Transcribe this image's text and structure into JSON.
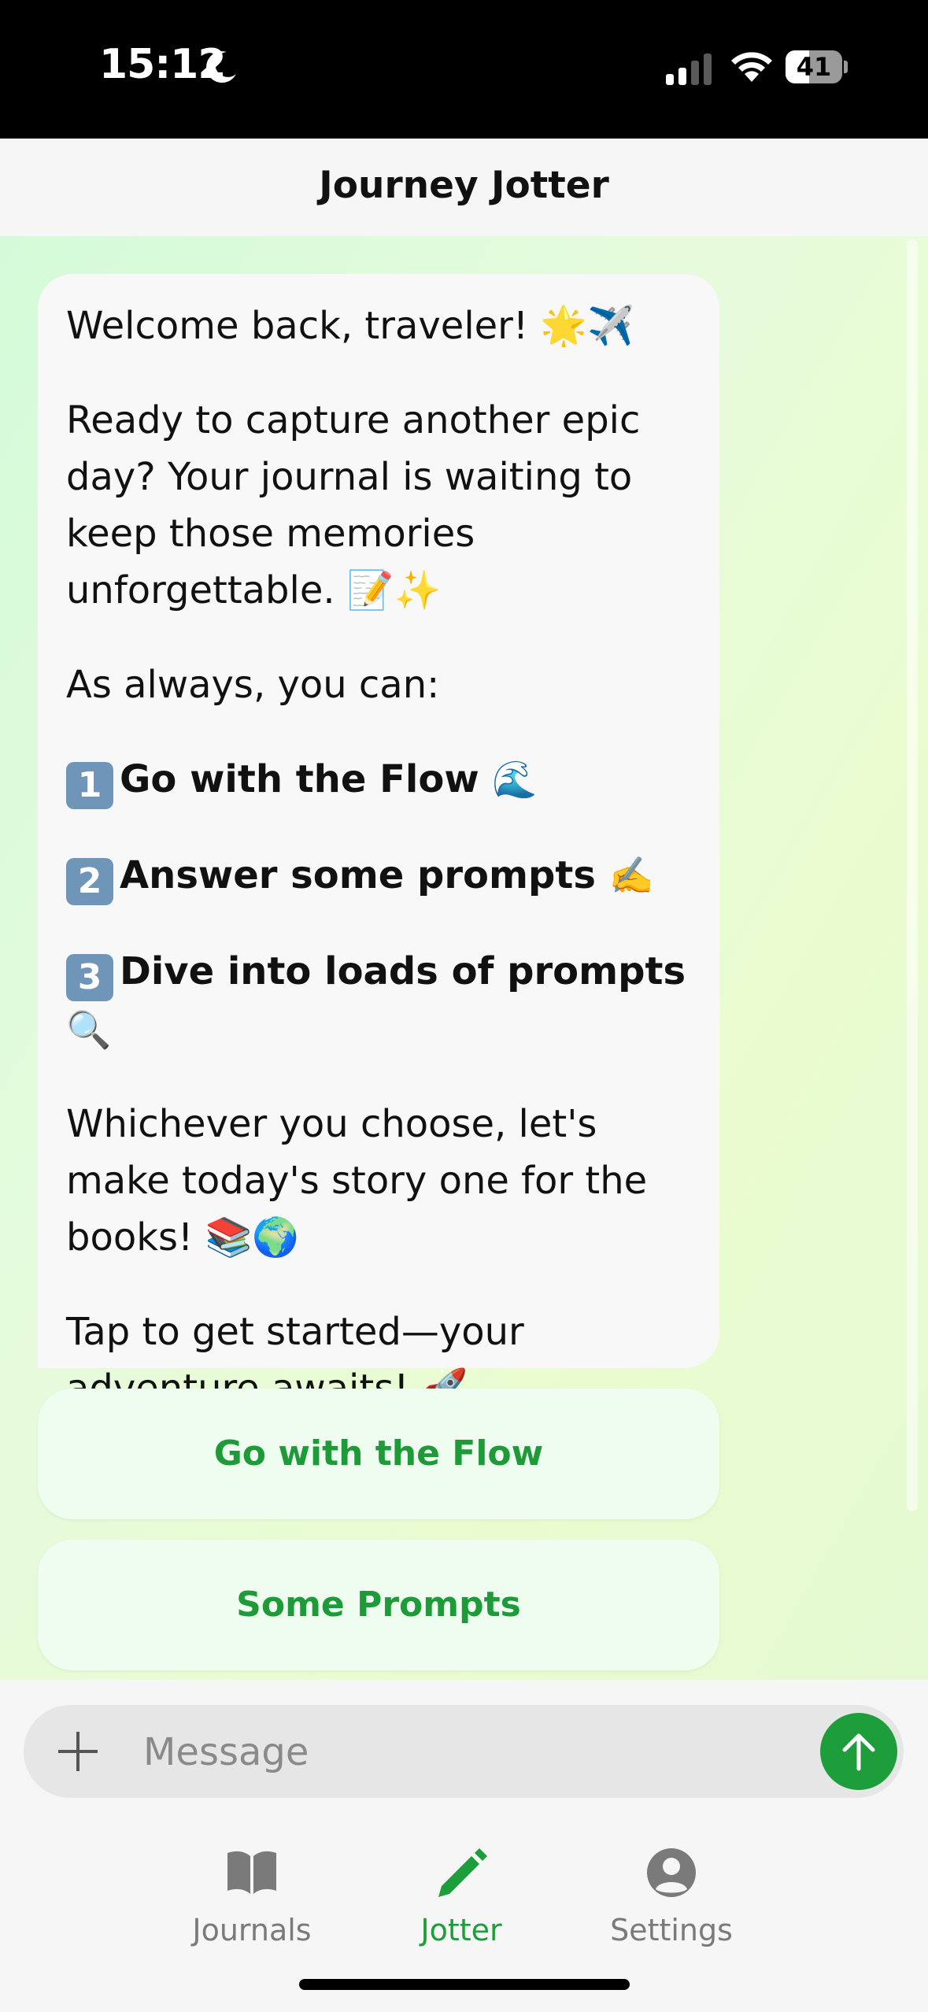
{
  "status": {
    "time": "15:12",
    "battery": "41",
    "battery_level": 0.41
  },
  "header": {
    "title": "Journey Jotter"
  },
  "message": {
    "greeting": "Welcome back, traveler! 🌟✈️",
    "intro": "Ready to capture another epic day? Your journal is waiting to keep those memories unforgettable. 📝✨",
    "lead": "As always, you can:",
    "options": [
      {
        "key": "1",
        "label": "Go with the Flow",
        "emoji": "🌊"
      },
      {
        "key": "2",
        "label": "Answer some prompts",
        "emoji": "✍️"
      },
      {
        "key": "3",
        "label": "Dive into loads of prompts",
        "emoji": "🔍"
      }
    ],
    "closing": "Whichever you choose, let's make today's story one for the books! 📚🌍",
    "cta": "Tap to get started—your adventure awaits! 🚀"
  },
  "actions": [
    {
      "label": "Go with the Flow"
    },
    {
      "label": "Some Prompts"
    }
  ],
  "composer": {
    "placeholder": "Message",
    "value": ""
  },
  "tabs": [
    {
      "label": "Journals",
      "icon": "book-icon",
      "active": false
    },
    {
      "label": "Jotter",
      "icon": "pencil-icon",
      "active": true
    },
    {
      "label": "Settings",
      "icon": "person-icon",
      "active": false
    }
  ],
  "colors": {
    "accent": "#1e9e3b",
    "bubble": "#f8f8f8",
    "action_bg": "#eefdef"
  }
}
